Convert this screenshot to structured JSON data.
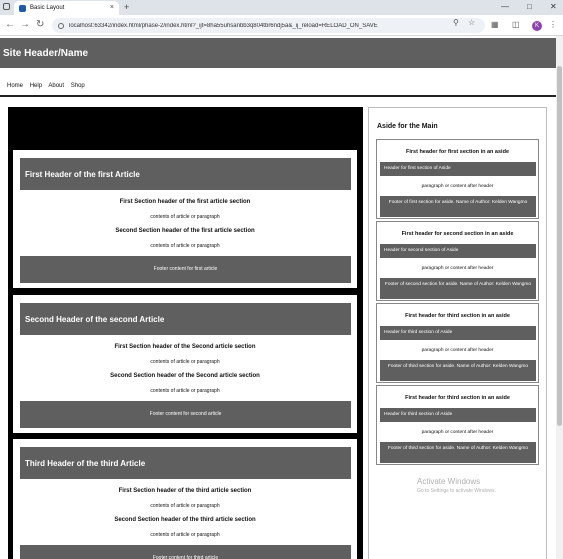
{
  "browser": {
    "tab_title": "Basic Layout",
    "tab_close": "×",
    "new_tab": "+",
    "url": "localhost:63342/index.html/phase-2/index.html?_ijt=8ha55uhsanbb3q804tbr6ndj5a&_ij_reload=RELOAD_ON_SAVE",
    "profile_initial": "K",
    "icons": [
      "back-icon",
      "forward-icon",
      "reload-icon",
      "zoom-icon",
      "star-icon",
      "extensions-icon",
      "sidebar-icon",
      "menu-icon"
    ]
  },
  "site": {
    "header": "Site Header/Name",
    "nav": [
      "Home",
      "Help",
      "About",
      "Shop"
    ]
  },
  "articles": [
    {
      "header": "First Header of the first Article",
      "sections": [
        {
          "heading": "First Section header of the first article section",
          "content": "contents of article or paragraph"
        },
        {
          "heading": "Second Section header of the first article section",
          "content": "contents of article or paragraph"
        }
      ],
      "footer": "Footer content for first article"
    },
    {
      "header": "Second Header of the second Article",
      "sections": [
        {
          "heading": "First Section header of the Second article section",
          "content": "contents of article or paragraph"
        },
        {
          "heading": "Second Section header of the Second article section",
          "content": "contents of article or paragraph"
        }
      ],
      "footer": "Footer content for second article"
    },
    {
      "header": "Third Header of the third Article",
      "sections": [
        {
          "heading": "First Section header of the third article section",
          "content": "contents of article or paragraph"
        },
        {
          "heading": "Second Section header of the third article section",
          "content": "contents of article or paragraph"
        }
      ],
      "footer": "Footer content for third article"
    }
  ],
  "aside": {
    "title": "Aside for the Main",
    "sections": [
      {
        "heading": "First header for first section in an aside",
        "header": "Header for first section of Aside",
        "paragraph": "paragraph or content after header",
        "footer": "Footer of first section for aside. Name of Author: Kelden Wangmo"
      },
      {
        "heading": "First header for second section in an aside",
        "header": "Header for second section of Aside",
        "paragraph": "paragraph or content after header",
        "footer": "Footer of second section for aside. Name of Author: Kelden Wangmo"
      },
      {
        "heading": "First header for third section in an aside",
        "header": "Header for third section of Aside",
        "paragraph": "paragraph or content after header",
        "footer": "Footer of third section for aside. Name of Author: Kelden Wangmo"
      },
      {
        "heading": "First header for third section in an aside",
        "header": "Header for third section of Aside",
        "paragraph": "paragraph or content after header",
        "footer": "Footer of third section for aside. Name of Author: Kelden Wangmo"
      }
    ]
  },
  "watermark": {
    "line1": "Activate Windows",
    "line2": "Go to Settings to activate Windows."
  },
  "colors": {
    "header_gray": "#5f5f5f",
    "main_background": "#000000",
    "chrome_tabstrip": "#dee3ea"
  }
}
